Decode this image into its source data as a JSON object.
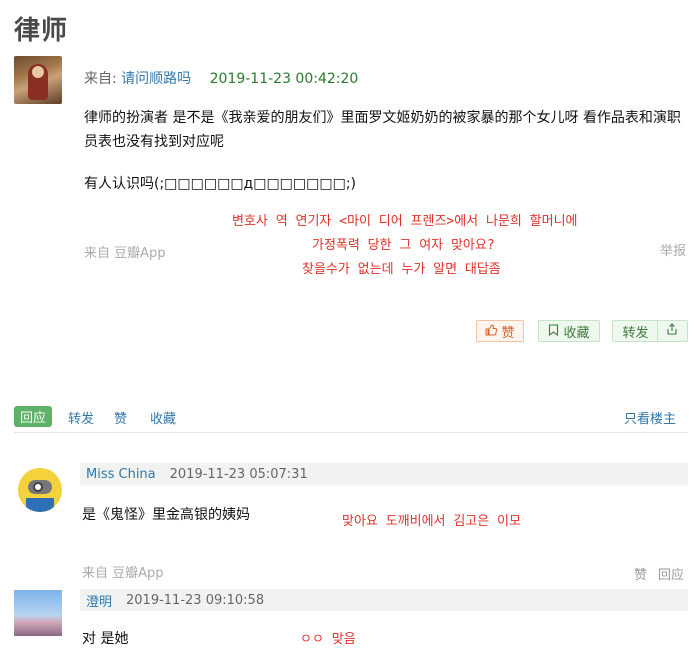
{
  "page": {
    "title": "律师"
  },
  "post": {
    "from_label": "来自:",
    "author": "请问顺路吗",
    "time": "2019-11-23 00:42:20",
    "paragraph1": "律师的扮演者 是不是《我亲爱的朋友们》里面罗文姬奶奶的被家暴的那个女儿呀 看作品表和演职员表也没有找到对应呢",
    "paragraph2": "有人认识吗(;□□□□□□д□□□□□□□;)",
    "korean_lines": [
      "변호사 역 연기자 <마이 디어 프렌즈>에서 나문희 할머니에",
      "가정폭력 당한 그 여자 맞아요?",
      "찾을수가 없는데 누가 알면 대답좀"
    ],
    "source": "来自 豆瓣App",
    "report": "举报",
    "like_label": "赞",
    "fav_label": "收藏",
    "share_label": "转发"
  },
  "tabs": {
    "reply": "回应",
    "share": "转发",
    "like": "赞",
    "fav": "收藏",
    "op_only": "只看楼主"
  },
  "comments": [
    {
      "author": "Miss China",
      "time": "2019-11-23 05:07:31",
      "text": "是《鬼怪》里金高银的姨妈",
      "korean": "맞아요 도깨비에서 김고은 이모",
      "source": "来自 豆瓣App",
      "like": "赞",
      "reply": "回应"
    },
    {
      "author": "澄明",
      "time": "2019-11-23 09:10:58",
      "text": "对 是她",
      "korean": "ㅇㅇ 맞음"
    }
  ],
  "icons": {
    "like": "thumbs-up-icon",
    "fav": "bookmark-icon",
    "share": "share-icon"
  },
  "colors": {
    "link": "#3377aa",
    "time_green": "#2b7a2b",
    "annotation_red": "#e0322a",
    "reply_tab_bg": "#5fb168"
  }
}
